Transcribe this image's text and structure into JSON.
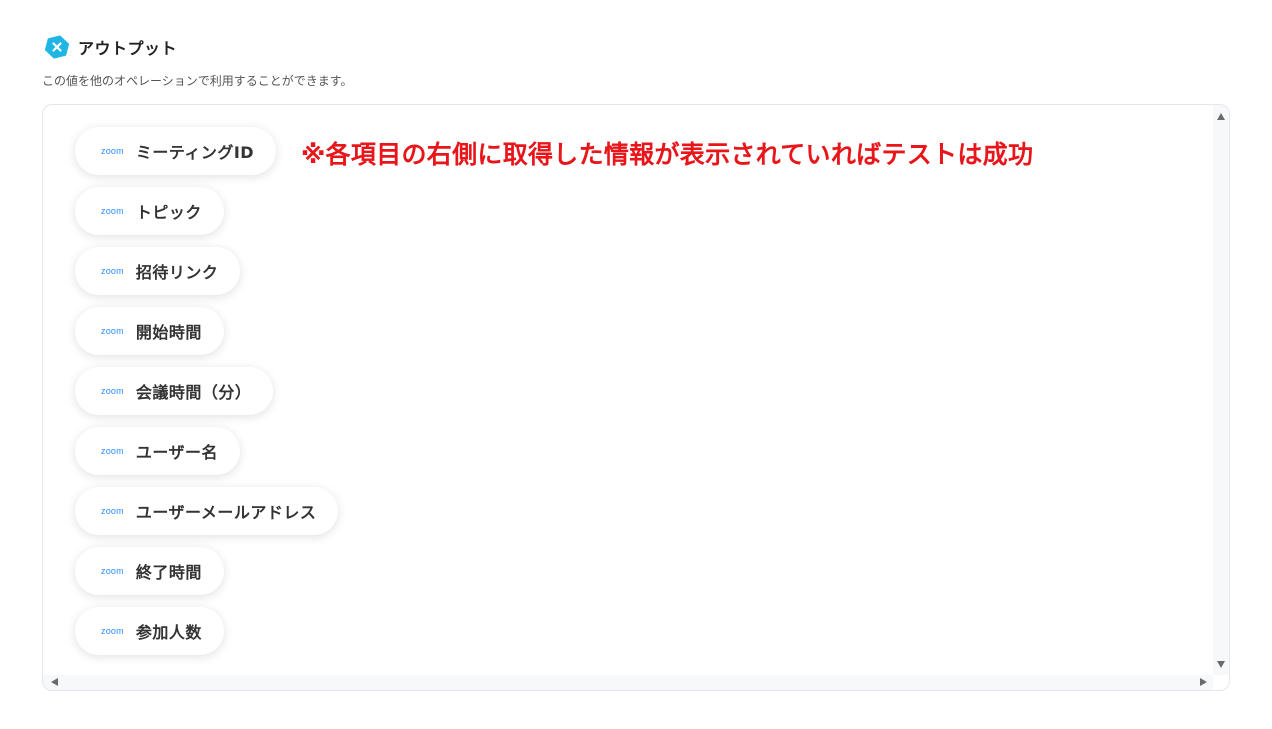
{
  "header": {
    "title": "アウトプット",
    "icon": "yoom-close-icon",
    "accent": "#1fb6e5"
  },
  "description": "この値を他のオペレーションで利用することができます。",
  "annotation": {
    "text": "※各項目の右側に取得した情報が表示されていればテストは成功",
    "color": "#e8161a"
  },
  "outputs": {
    "source_label": "zoom",
    "source_color": "#2D8CFF",
    "items": [
      {
        "label": "ミーティングID"
      },
      {
        "label": "トピック"
      },
      {
        "label": "招待リンク"
      },
      {
        "label": "開始時間"
      },
      {
        "label": "会議時間（分）"
      },
      {
        "label": "ユーザー名"
      },
      {
        "label": "ユーザーメールアドレス"
      },
      {
        "label": "終了時間"
      },
      {
        "label": "参加人数"
      }
    ]
  }
}
